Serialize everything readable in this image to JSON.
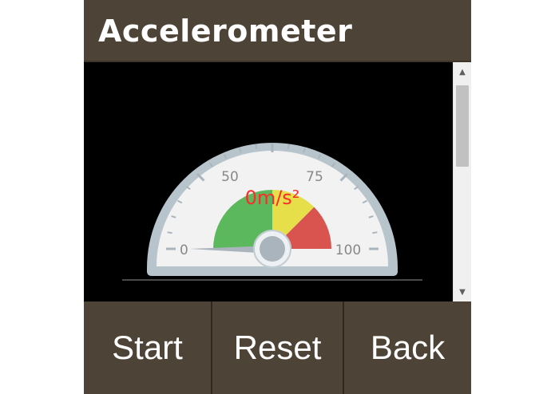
{
  "header": {
    "title": "Accelerometer"
  },
  "gauge": {
    "value": 0,
    "value_text": "0m/s²",
    "min": 0,
    "max": 100,
    "tick_labels": [
      "0",
      "50",
      "75",
      "100"
    ],
    "bands": [
      {
        "from": 0,
        "to": 50,
        "color": "#5cb85c"
      },
      {
        "from": 50,
        "to": 75,
        "color": "#e6df4a"
      },
      {
        "from": 75,
        "to": 100,
        "color": "#d9534f"
      }
    ],
    "value_color": "#ff2a2a"
  },
  "buttons": {
    "start": "Start",
    "reset": "Reset",
    "back": "Back"
  },
  "colors": {
    "bar_background": "#4e4337",
    "content_background": "#000000"
  }
}
